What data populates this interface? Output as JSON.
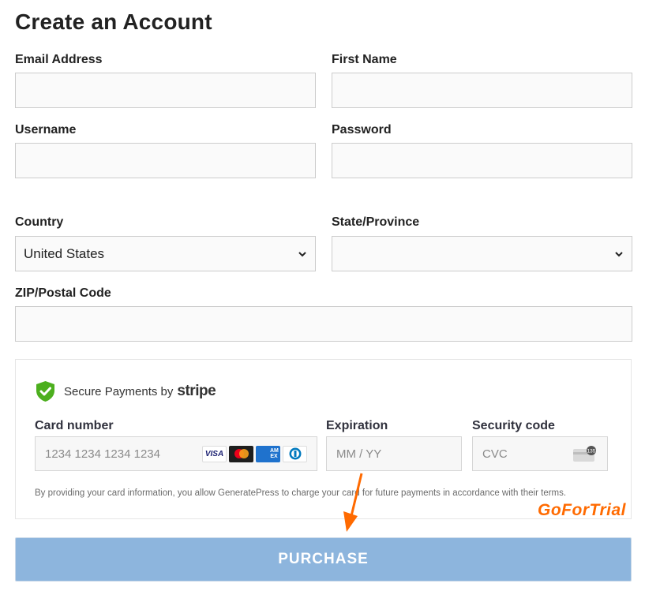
{
  "page": {
    "title": "Create an Account"
  },
  "form": {
    "email": {
      "label": "Email Address",
      "value": "",
      "placeholder": ""
    },
    "first_name": {
      "label": "First Name",
      "value": "",
      "placeholder": ""
    },
    "username": {
      "label": "Username",
      "value": "",
      "placeholder": ""
    },
    "password": {
      "label": "Password",
      "value": "",
      "placeholder": ""
    },
    "country": {
      "label": "Country",
      "selected": "United States"
    },
    "state": {
      "label": "State/Province",
      "selected": ""
    },
    "zip": {
      "label": "ZIP/Postal Code",
      "value": "",
      "placeholder": ""
    }
  },
  "payment": {
    "secure_text": "Secure Payments by",
    "provider": "stripe",
    "card_number": {
      "label": "Card number",
      "placeholder": "1234 1234 1234 1234"
    },
    "card_brands": [
      "VISA",
      "Mastercard",
      "AMEX",
      "Diners Club"
    ],
    "amex_text": "AM EX",
    "visa_text": "VISA",
    "expiration": {
      "label": "Expiration",
      "placeholder": "MM / YY"
    },
    "security_code": {
      "label": "Security code",
      "placeholder": "CVC",
      "icon_text": "135"
    },
    "terms": "By providing your card information, you allow GeneratePress to charge your card for future payments in accordance with their terms."
  },
  "actions": {
    "purchase_label": "PURCHASE"
  },
  "watermark": "GoForTrial",
  "colors": {
    "accent_button": "#8db5dd",
    "shield_green": "#4caf1e",
    "watermark_orange": "#ff6a00"
  }
}
